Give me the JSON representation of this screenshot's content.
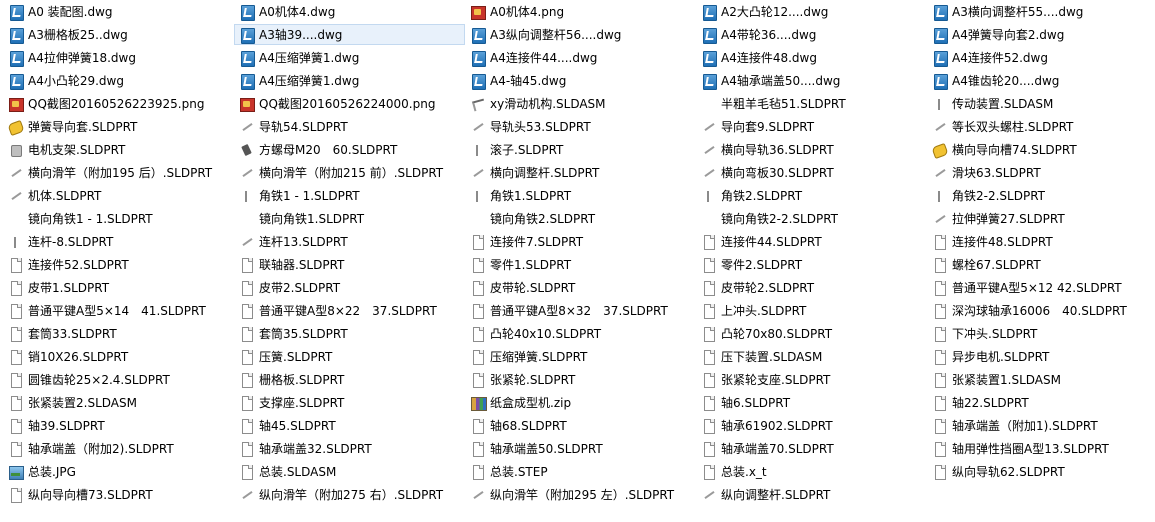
{
  "window": {
    "view": "list",
    "selected_index": 23
  },
  "files": [
    {
      "name": "A0 装配图.dwg",
      "icon": "dwg-icon"
    },
    {
      "name": "A3栅格板25..dwg",
      "icon": "dwg-icon"
    },
    {
      "name": "A4拉伸弹簧18.dwg",
      "icon": "dwg-icon"
    },
    {
      "name": "A4小凸轮29.dwg",
      "icon": "dwg-icon"
    },
    {
      "name": "QQ截图20160526223925.png",
      "icon": "png-icon"
    },
    {
      "name": "弹簧导向套.SLDPRT",
      "icon": "gold-part-icon"
    },
    {
      "name": "电机支架.SLDPRT",
      "icon": "motor-part-icon"
    },
    {
      "name": "横向滑竿（附加195 后）.SLDPRT",
      "icon": "thin-part-icon"
    },
    {
      "name": "机体.SLDPRT",
      "icon": "thin-part-icon"
    },
    {
      "name": "镜向角铁1 - 1.SLDPRT",
      "icon": "blank-part-icon"
    },
    {
      "name": "连杆-8.SLDPRT",
      "icon": "vbar-part-icon"
    },
    {
      "name": "连接件52.SLDPRT",
      "icon": "document-icon"
    },
    {
      "name": "皮带1.SLDPRT",
      "icon": "document-icon"
    },
    {
      "name": "普通平键A型5×14　41.SLDPRT",
      "icon": "document-icon"
    },
    {
      "name": "套筒33.SLDPRT",
      "icon": "document-icon"
    },
    {
      "name": "销10X26.SLDPRT",
      "icon": "document-icon"
    },
    {
      "name": "圆锥齿轮25×2.4.SLDPRT",
      "icon": "document-icon"
    },
    {
      "name": "张紧装置2.SLDASM",
      "icon": "document-icon"
    },
    {
      "name": "轴39.SLDPRT",
      "icon": "document-icon"
    },
    {
      "name": "轴承端盖（附加2).SLDPRT",
      "icon": "document-icon"
    },
    {
      "name": "总装.JPG",
      "icon": "jpg-icon"
    },
    {
      "name": "纵向导向槽73.SLDPRT",
      "icon": "document-icon"
    },
    {
      "name": "A0机体4.dwg",
      "icon": "dwg-icon"
    },
    {
      "name": "A3轴39....dwg",
      "icon": "dwg-icon"
    },
    {
      "name": "A4压缩弹簧1.dwg",
      "icon": "dwg-icon"
    },
    {
      "name": "A4压缩弹簧1.dwg",
      "icon": "dwg-icon"
    },
    {
      "name": "QQ截图20160526224000.png",
      "icon": "png-icon"
    },
    {
      "name": "导轨54.SLDPRT",
      "icon": "thin-part-icon"
    },
    {
      "name": "方螺母M20　60.SLDPRT",
      "icon": "dark-part-icon"
    },
    {
      "name": "横向滑竿（附加215 前）.SLDPRT",
      "icon": "thin-part-icon"
    },
    {
      "name": "角铁1 - 1.SLDPRT",
      "icon": "vbar-part-icon"
    },
    {
      "name": "镜向角铁1.SLDPRT",
      "icon": "blank-part-icon"
    },
    {
      "name": "连杆13.SLDPRT",
      "icon": "thin-part-icon"
    },
    {
      "name": "联轴器.SLDPRT",
      "icon": "document-icon"
    },
    {
      "name": "皮带2.SLDPRT",
      "icon": "document-icon"
    },
    {
      "name": "普通平键A型8×22　37.SLDPRT",
      "icon": "document-icon"
    },
    {
      "name": "套筒35.SLDPRT",
      "icon": "document-icon"
    },
    {
      "name": "压簧.SLDPRT",
      "icon": "document-icon"
    },
    {
      "name": "栅格板.SLDPRT",
      "icon": "document-icon"
    },
    {
      "name": "支撑座.SLDPRT",
      "icon": "document-icon"
    },
    {
      "name": "轴45.SLDPRT",
      "icon": "document-icon"
    },
    {
      "name": "轴承端盖32.SLDPRT",
      "icon": "document-icon"
    },
    {
      "name": "总装.SLDASM",
      "icon": "document-icon"
    },
    {
      "name": "纵向滑竿（附加275 右）.SLDPRT",
      "icon": "thin-part-icon"
    },
    {
      "name": "A0机体4.png",
      "icon": "png-icon"
    },
    {
      "name": "A3纵向调整杆56....dwg",
      "icon": "dwg-icon"
    },
    {
      "name": "A4连接件44....dwg",
      "icon": "dwg-icon"
    },
    {
      "name": "A4-轴45.dwg",
      "icon": "dwg-icon"
    },
    {
      "name": "xy滑动机构.SLDASM",
      "icon": "xy-assembly-icon"
    },
    {
      "name": "导轨头53.SLDPRT",
      "icon": "thin-part-icon"
    },
    {
      "name": "滚子.SLDPRT",
      "icon": "vbar-part-icon"
    },
    {
      "name": "横向调整杆.SLDPRT",
      "icon": "thin-part-icon"
    },
    {
      "name": "角铁1.SLDPRT",
      "icon": "vbar-part-icon"
    },
    {
      "name": "镜向角铁2.SLDPRT",
      "icon": "blank-part-icon"
    },
    {
      "name": "连接件7.SLDPRT",
      "icon": "document-icon"
    },
    {
      "name": "零件1.SLDPRT",
      "icon": "document-icon"
    },
    {
      "name": "皮带轮.SLDPRT",
      "icon": "document-icon"
    },
    {
      "name": "普通平键A型8×32　37.SLDPRT",
      "icon": "document-icon"
    },
    {
      "name": "凸轮40x10.SLDPRT",
      "icon": "document-icon"
    },
    {
      "name": "压缩弹簧.SLDPRT",
      "icon": "document-icon"
    },
    {
      "name": "张紧轮.SLDPRT",
      "icon": "document-icon"
    },
    {
      "name": "纸盒成型机.zip",
      "icon": "zip-icon"
    },
    {
      "name": "轴68.SLDPRT",
      "icon": "document-icon"
    },
    {
      "name": "轴承端盖50.SLDPRT",
      "icon": "document-icon"
    },
    {
      "name": "总装.STEP",
      "icon": "document-icon"
    },
    {
      "name": "纵向滑竿（附加295 左）.SLDPRT",
      "icon": "thin-part-icon"
    },
    {
      "name": "A2大凸轮12....dwg",
      "icon": "dwg-icon"
    },
    {
      "name": "A4带轮36....dwg",
      "icon": "dwg-icon"
    },
    {
      "name": "A4连接件48.dwg",
      "icon": "dwg-icon"
    },
    {
      "name": "A4轴承端盖50....dwg",
      "icon": "dwg-icon"
    },
    {
      "name": "半粗羊毛毡51.SLDPRT",
      "icon": "blank-part-icon"
    },
    {
      "name": "导向套9.SLDPRT",
      "icon": "thin-part-icon"
    },
    {
      "name": "横向导轨36.SLDPRT",
      "icon": "thin-part-icon"
    },
    {
      "name": "横向弯板30.SLDPRT",
      "icon": "thin-part-icon"
    },
    {
      "name": "角铁2.SLDPRT",
      "icon": "vbar-part-icon"
    },
    {
      "name": "镜向角铁2-2.SLDPRT",
      "icon": "blank-part-icon"
    },
    {
      "name": "连接件44.SLDPRT",
      "icon": "document-icon"
    },
    {
      "name": "零件2.SLDPRT",
      "icon": "document-icon"
    },
    {
      "name": "皮带轮2.SLDPRT",
      "icon": "document-icon"
    },
    {
      "name": "上冲头.SLDPRT",
      "icon": "document-icon"
    },
    {
      "name": "凸轮70x80.SLDPRT",
      "icon": "document-icon"
    },
    {
      "name": "压下装置.SLDASM",
      "icon": "document-icon"
    },
    {
      "name": "张紧轮支座.SLDPRT",
      "icon": "document-icon"
    },
    {
      "name": "轴6.SLDPRT",
      "icon": "document-icon"
    },
    {
      "name": "轴承61902.SLDPRT",
      "icon": "document-icon"
    },
    {
      "name": "轴承端盖70.SLDPRT",
      "icon": "document-icon"
    },
    {
      "name": "总装.x_t",
      "icon": "document-icon"
    },
    {
      "name": "纵向调整杆.SLDPRT",
      "icon": "thin-part-icon"
    },
    {
      "name": "A3横向调整杆55....dwg",
      "icon": "dwg-icon"
    },
    {
      "name": "A4弹簧导向套2.dwg",
      "icon": "dwg-icon"
    },
    {
      "name": "A4连接件52.dwg",
      "icon": "dwg-icon"
    },
    {
      "name": "A4锥齿轮20....dwg",
      "icon": "dwg-icon"
    },
    {
      "name": "传动装置.SLDASM",
      "icon": "vbar-part-icon"
    },
    {
      "name": "等长双头螺柱.SLDPRT",
      "icon": "thin-part-icon"
    },
    {
      "name": "横向导向槽74.SLDPRT",
      "icon": "gold-part-icon"
    },
    {
      "name": "滑块63.SLDPRT",
      "icon": "thin-part-icon"
    },
    {
      "name": "角铁2-2.SLDPRT",
      "icon": "vbar-part-icon"
    },
    {
      "name": "拉伸弹簧27.SLDPRT",
      "icon": "thin-part-icon"
    },
    {
      "name": "连接件48.SLDPRT",
      "icon": "document-icon"
    },
    {
      "name": "螺栓67.SLDPRT",
      "icon": "document-icon"
    },
    {
      "name": "普通平键A型5×12 42.SLDPRT",
      "icon": "document-icon"
    },
    {
      "name": "深沟球轴承16006　40.SLDPRT",
      "icon": "document-icon"
    },
    {
      "name": "下冲头.SLDPRT",
      "icon": "document-icon"
    },
    {
      "name": "异步电机.SLDPRT",
      "icon": "document-icon"
    },
    {
      "name": "张紧装置1.SLDASM",
      "icon": "document-icon"
    },
    {
      "name": "轴22.SLDPRT",
      "icon": "document-icon"
    },
    {
      "name": "轴承端盖（附加1).SLDPRT",
      "icon": "document-icon"
    },
    {
      "name": "轴用弹性挡圈A型13.SLDPRT",
      "icon": "document-icon"
    },
    {
      "name": "纵向导轨62.SLDPRT",
      "icon": "document-icon"
    }
  ]
}
